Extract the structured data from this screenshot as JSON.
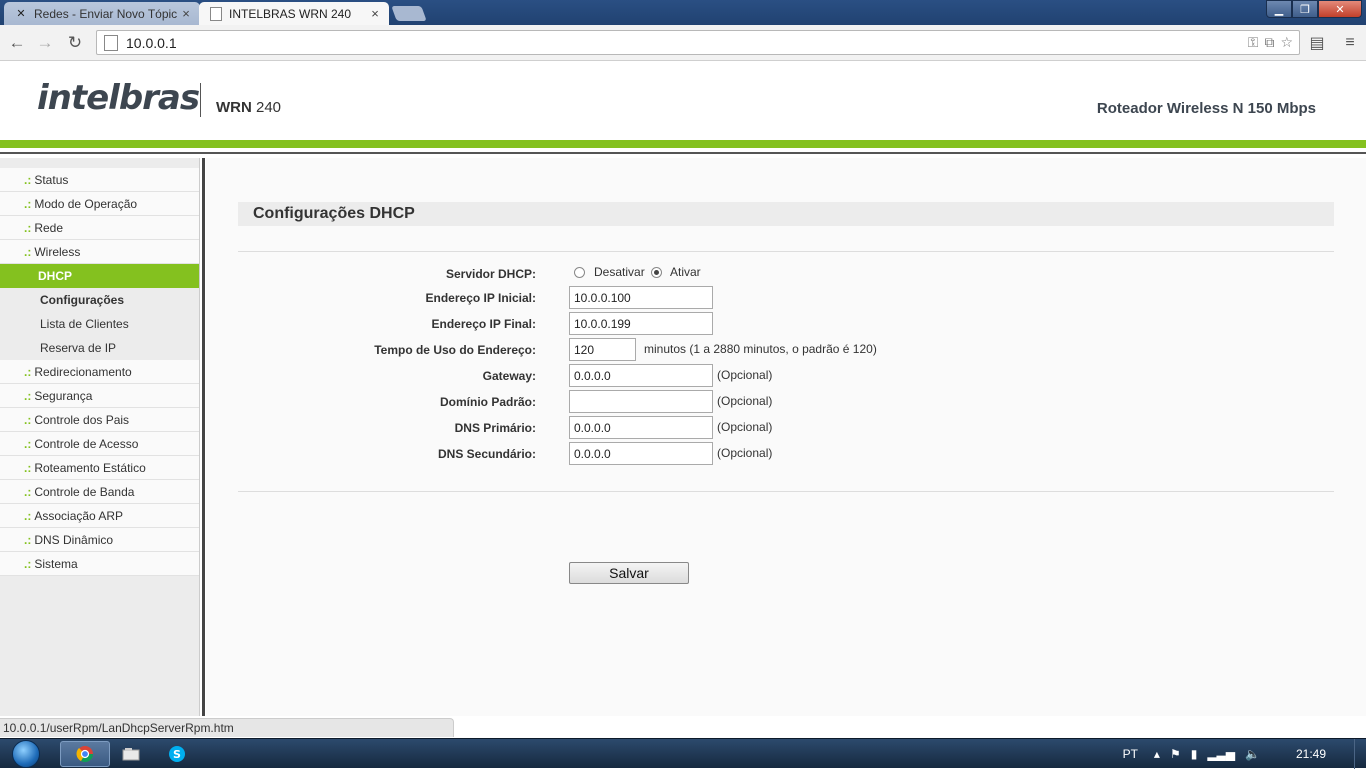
{
  "browser": {
    "tabs": [
      {
        "title": "Redes - Enviar Novo Tópic",
        "active": false
      },
      {
        "title": "INTELBRAS WRN 240",
        "active": true
      }
    ],
    "url": "10.0.0.1",
    "status_url": "10.0.0.1/userRpm/LanDhcpServerRpm.htm"
  },
  "header": {
    "logo": "intelbras",
    "model_bold": "WRN",
    "model_num": "240",
    "product": "Roteador Wireless N 150 Mbps"
  },
  "sidebar": {
    "items": [
      {
        "label": "Status"
      },
      {
        "label": "Modo de Operação"
      },
      {
        "label": "Rede"
      },
      {
        "label": "Wireless"
      },
      {
        "label": "DHCP"
      },
      {
        "label": "Configurações"
      },
      {
        "label": "Lista de Clientes"
      },
      {
        "label": "Reserva de IP"
      },
      {
        "label": "Redirecionamento"
      },
      {
        "label": "Segurança"
      },
      {
        "label": "Controle dos Pais"
      },
      {
        "label": "Controle de Acesso"
      },
      {
        "label": "Roteamento Estático"
      },
      {
        "label": "Controle de Banda"
      },
      {
        "label": "Associação ARP"
      },
      {
        "label": "DNS Dinâmico"
      },
      {
        "label": "Sistema"
      }
    ],
    "bullet": ".:"
  },
  "main": {
    "title": "Configurações DHCP",
    "server_label": "Servidor DHCP:",
    "server_off": "Desativar",
    "server_on": "Ativar",
    "server_selected": "Ativar",
    "fields": {
      "ip_start": {
        "label": "Endereço IP Inicial:",
        "value": "10.0.0.100"
      },
      "ip_end": {
        "label": "Endereço IP Final:",
        "value": "10.0.0.199"
      },
      "lease": {
        "label": "Tempo de Uso do Endereço:",
        "value": "120",
        "note": "minutos (1 a 2880 minutos, o padrão é 120)"
      },
      "gateway": {
        "label": "Gateway:",
        "value": "0.0.0.0",
        "note": "(Opcional)"
      },
      "domain": {
        "label": "Domínio Padrão:",
        "value": "",
        "note": "(Opcional)"
      },
      "dns1": {
        "label": "DNS Primário:",
        "value": "0.0.0.0",
        "note": "(Opcional)"
      },
      "dns2": {
        "label": "DNS Secundário:",
        "value": "0.0.0.0",
        "note": "(Opcional)"
      }
    },
    "save_label": "Salvar"
  },
  "taskbar": {
    "lang": "PT",
    "clock": "21:49"
  }
}
